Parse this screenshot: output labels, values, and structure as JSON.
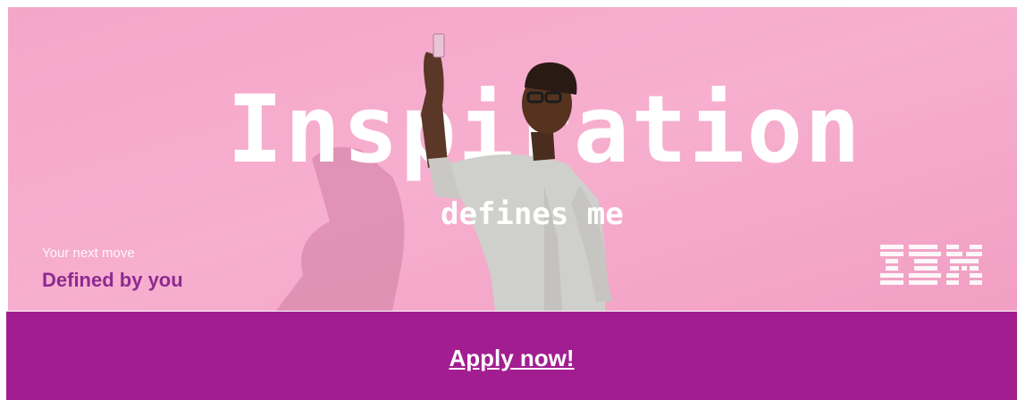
{
  "hero": {
    "headline": "Inspiration",
    "subhead": "defines me",
    "tagline_small": "Your next move",
    "tagline_big": "Defined by you",
    "logo_text": "IBM",
    "background_color": "#f5a8cb"
  },
  "cta": {
    "label": "Apply now!",
    "background_color": "#a21e90"
  },
  "colors": {
    "accent_purple": "#8d2a8f",
    "text_white": "#ffffff"
  },
  "icons": {
    "logo": "ibm-logo",
    "photo": "person-taking-selfie"
  }
}
